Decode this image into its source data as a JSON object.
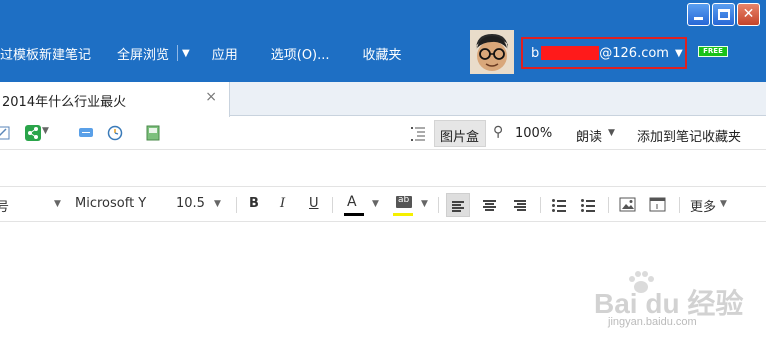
{
  "nav": {
    "items": [
      {
        "label": "过模板新建笔记"
      },
      {
        "label": "全屏浏览"
      },
      {
        "label": "应用"
      },
      {
        "label": "选项(O)..."
      },
      {
        "label": "收藏夹"
      }
    ]
  },
  "account": {
    "prefix": "b",
    "domain": "@126.com",
    "badge": "FREE"
  },
  "tab": {
    "title": "2014年什么行业最火",
    "close": "×"
  },
  "note_toolbar": {
    "image_box_label": "图片盒",
    "zoom": "100%",
    "read_label": "朗读",
    "add_to_favorites": "添加到笔记收藏夹"
  },
  "format_toolbar": {
    "font_size_name_partial": "号",
    "font_family": "Microsoft Y",
    "font_size": "10.5",
    "bold": "B",
    "italic": "I",
    "underline": "U",
    "font_color_label": "A",
    "highlight_label": "ab",
    "more_label": "更多"
  },
  "colors": {
    "header_bg": "#1e6fc4",
    "highlight_account_border": "#e02020",
    "free_badge": "#19c219",
    "highlight_swatch": "#f5f000",
    "font_color_swatch": "#000000"
  },
  "watermark": {
    "text": "Bai du 经验",
    "url": "jingyan.baidu.com"
  }
}
